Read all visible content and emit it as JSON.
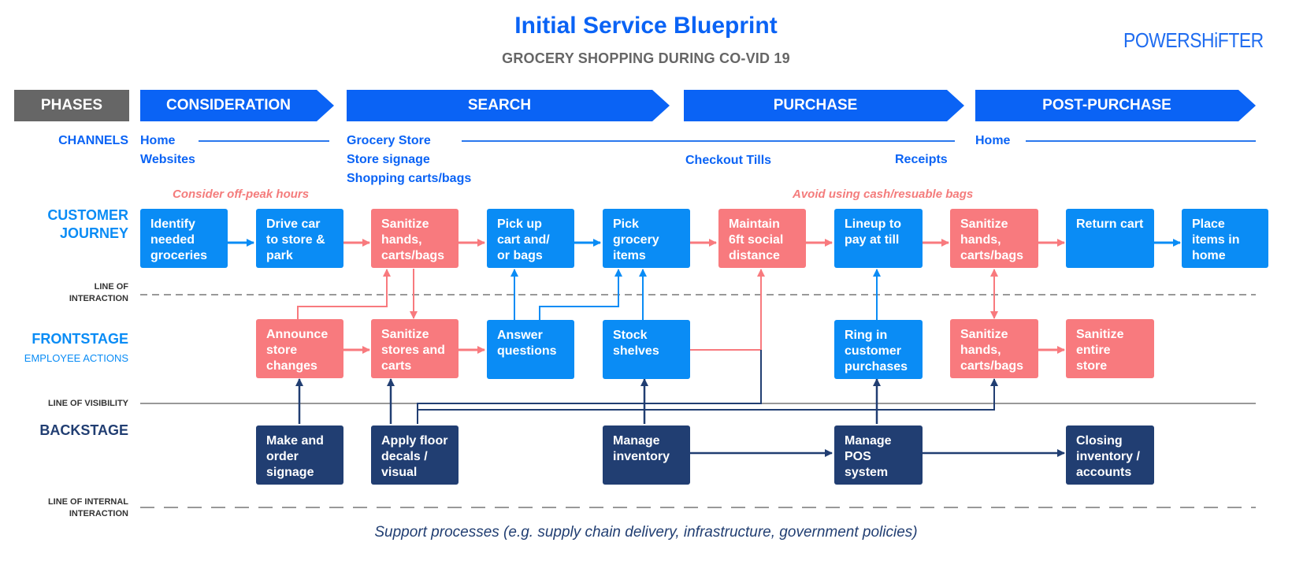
{
  "header": {
    "title": "Initial Service Blueprint",
    "subtitle": "GROCERY SHOPPING DURING CO-VID 19",
    "logo": "POWERSHiFTER"
  },
  "phases": {
    "label": "PHASES",
    "items": [
      "CONSIDERATION",
      "SEARCH",
      "PURCHASE",
      "POST-PURCHASE"
    ]
  },
  "channels": {
    "label": "CHANNELS",
    "consideration": [
      "Home",
      "Websites"
    ],
    "search": [
      "Grocery Store",
      "Store signage",
      "Shopping carts/bags"
    ],
    "purchase": [
      "Checkout Tills",
      "Receipts"
    ],
    "post_purchase": [
      "Home"
    ]
  },
  "notes": {
    "off_peak": "Consider off-peak hours",
    "avoid_cash": "Avoid using cash/resuable bags"
  },
  "rows": {
    "customer_journey": [
      "CUSTOMER",
      "JOURNEY"
    ],
    "line_of_interaction": [
      "LINE OF",
      "INTERACTION"
    ],
    "frontstage": "FRONTSTAGE",
    "frontstage_sub": "EMPLOYEE ACTIONS",
    "line_of_visibility": "LINE OF VISIBILITY",
    "backstage": "BACKSTAGE",
    "line_of_internal": [
      "LINE OF INTERNAL",
      "INTERACTION"
    ]
  },
  "customer_journey": [
    {
      "text": "Identify needed groceries",
      "type": "customer"
    },
    {
      "text": "Drive car to store & park",
      "type": "customer"
    },
    {
      "text": "Sanitize hands, carts/bags",
      "type": "covid"
    },
    {
      "text": "Pick up cart and/ or bags",
      "type": "customer"
    },
    {
      "text": "Pick grocery items",
      "type": "customer"
    },
    {
      "text": "Maintain 6ft social distance",
      "type": "covid"
    },
    {
      "text": "Lineup to pay at till",
      "type": "customer"
    },
    {
      "text": "Sanitize hands, carts/bags",
      "type": "covid"
    },
    {
      "text": "Return cart",
      "type": "customer"
    },
    {
      "text": "Place items in home",
      "type": "customer"
    }
  ],
  "frontstage": [
    {
      "text": "Announce store changes",
      "type": "covid"
    },
    {
      "text": "Sanitize stores and carts",
      "type": "covid"
    },
    {
      "text": "Answer questions",
      "type": "employee"
    },
    {
      "text": "Stock shelves",
      "type": "employee"
    },
    {
      "text": "Ring in customer purchases",
      "type": "employee"
    },
    {
      "text": "Sanitize hands, carts/bags",
      "type": "covid"
    },
    {
      "text": "Sanitize entire store",
      "type": "covid"
    }
  ],
  "backstage": [
    {
      "text": "Make and order signage",
      "type": "backstage"
    },
    {
      "text": "Apply floor decals / visual cues",
      "type": "backstage"
    },
    {
      "text": "Manage inventory",
      "type": "backstage"
    },
    {
      "text": "Manage POS system",
      "type": "backstage"
    },
    {
      "text": "Closing inventory / accounts",
      "type": "backstage"
    }
  ],
  "footer": {
    "support": "Support processes (e.g. supply chain delivery, infrastructure, government policies)"
  },
  "colors": {
    "brand_blue": "#0a63f5",
    "customer_blue": "#0a8cf5",
    "covid_red": "#f87a7e",
    "backstage_navy": "#213e72",
    "phase_gray": "#666666"
  }
}
